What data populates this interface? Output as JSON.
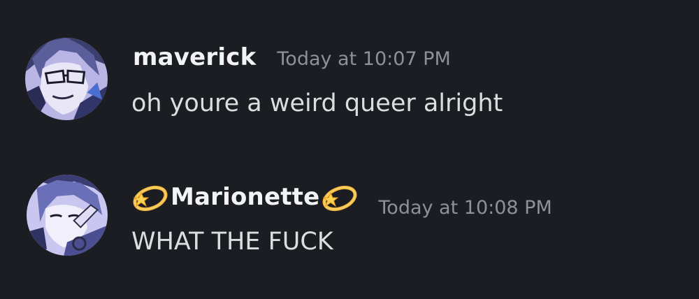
{
  "messages": [
    {
      "author": "maverick",
      "author_prefix_emoji": "",
      "author_suffix_emoji": "",
      "timestamp": "Today at 10:07 PM",
      "text": "oh youre a weird queer alright",
      "avatar_icon": "anime-character-with-glasses-avatar"
    },
    {
      "author": "Marionette",
      "author_prefix_emoji": "dizzy-emoji",
      "author_suffix_emoji": "dizzy-emoji",
      "timestamp": "Today at 10:08 PM",
      "text": "WHAT THE FUCK",
      "avatar_icon": "anime-character-blue-hair-avatar"
    }
  ],
  "colors": {
    "background": "#1c1d22",
    "username": "#f2f3f5",
    "timestamp": "#8e919a",
    "message_text": "#dbdee1"
  }
}
